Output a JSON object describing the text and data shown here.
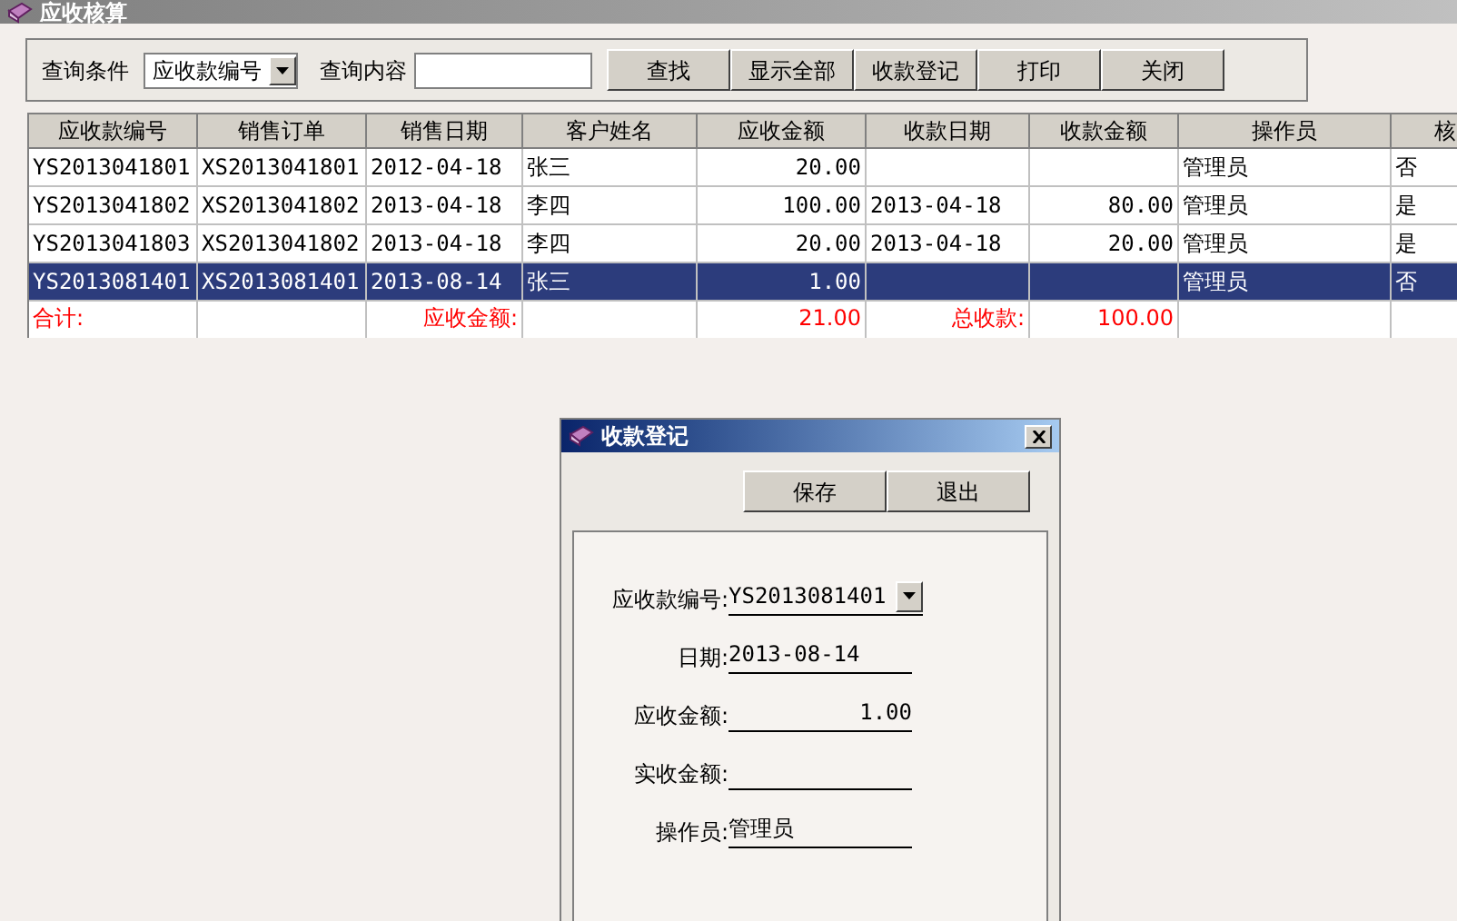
{
  "window": {
    "title": "应收核算"
  },
  "toolbar": {
    "condition_label": "查询条件",
    "condition_value": "应收款编号",
    "content_label": "查询内容",
    "buttons": [
      "查找",
      "显示全部",
      "收款登记",
      "打印",
      "关闭"
    ]
  },
  "table": {
    "columns": [
      "应收款编号",
      "销售订单",
      "销售日期",
      "客户姓名",
      "应收金额",
      "收款日期",
      "收款金额",
      "操作员",
      "核"
    ],
    "rows": [
      {
        "selected": false,
        "cells": [
          "YS2013041801",
          "XS2013041801",
          "2012-04-18",
          "张三",
          "20.00",
          null,
          null,
          "管理员",
          "否"
        ]
      },
      {
        "selected": false,
        "cells": [
          "YS2013041802",
          "XS2013041802",
          "2013-04-18",
          "李四",
          "100.00",
          "2013-04-18",
          "80.00",
          "管理员",
          "是"
        ]
      },
      {
        "selected": false,
        "cells": [
          "YS2013041803",
          "XS2013041802",
          "2013-04-18",
          "李四",
          "20.00",
          "2013-04-18",
          "20.00",
          "管理员",
          "是"
        ]
      },
      {
        "selected": true,
        "cells": [
          "YS2013081401",
          "XS2013081401",
          "2013-08-14",
          "张三",
          "1.00",
          null,
          null,
          "管理员",
          "否"
        ]
      }
    ],
    "totals": {
      "label": "合计:",
      "receivable_label": "应收金额:",
      "receivable_total": "21.00",
      "received_label": "总收款:",
      "received_total": "100.00"
    }
  },
  "dialog": {
    "title": "收款登记",
    "buttons": [
      "保存",
      "退出"
    ],
    "fields": [
      {
        "kind": "dropdown",
        "label": "应收款编号:",
        "value": "YS2013081401"
      },
      {
        "kind": "text",
        "label": "日期:",
        "value": "2013-08-14"
      },
      {
        "kind": "amount",
        "label": "应收金额:",
        "value": "1.00"
      },
      {
        "kind": "amount",
        "label": "实收金额:"
      },
      {
        "kind": "text",
        "label": "操作员:",
        "value": "管理员"
      }
    ]
  }
}
